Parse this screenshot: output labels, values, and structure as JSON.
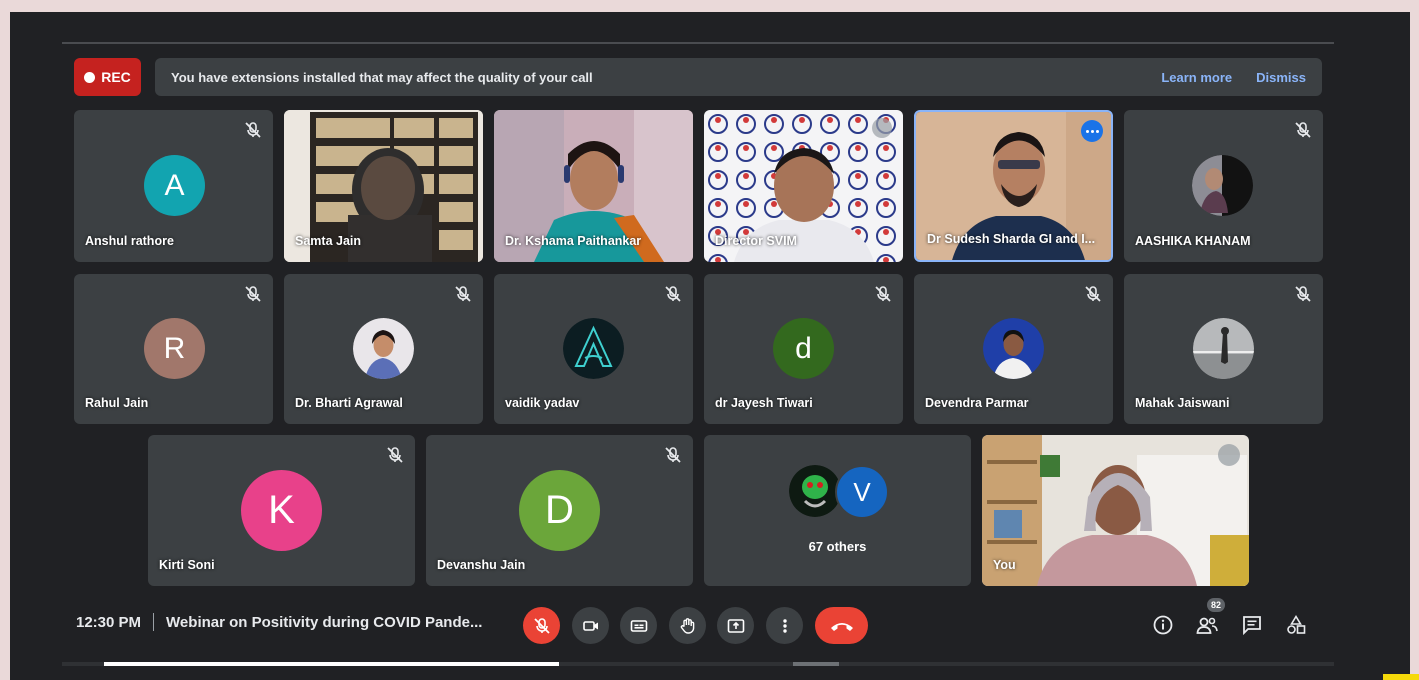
{
  "recording": {
    "label": "REC"
  },
  "notice": {
    "text": "You have extensions installed that may affect the quality of your call",
    "learn_more": "Learn more",
    "dismiss": "Dismiss"
  },
  "tiles": {
    "anshul": {
      "name": "Anshul rathore",
      "initial": "A",
      "color": "#12a4b0"
    },
    "samta": {
      "name": "Samta Jain"
    },
    "kshama": {
      "name": "Dr. Kshama Paithankar"
    },
    "director": {
      "name": "Director SVIM"
    },
    "sudesh": {
      "name": "Dr Sudesh Sharda GI and I..."
    },
    "aashika": {
      "name": "AASHIKA KHANAM"
    },
    "rahul": {
      "name": "Rahul Jain",
      "initial": "R",
      "color": "#a1776b"
    },
    "bharti": {
      "name": "Dr. Bharti Agrawal"
    },
    "vaidik": {
      "name": "vaidik yadav"
    },
    "jayesh": {
      "name": "dr Jayesh Tiwari",
      "initial": "d",
      "color": "#33691e"
    },
    "devendra": {
      "name": "Devendra Parmar"
    },
    "mahak": {
      "name": "Mahak Jaiswani"
    },
    "kirti": {
      "name": "Kirti Soni",
      "initial": "K",
      "color": "#e8418a"
    },
    "devanshu": {
      "name": "Devanshu Jain",
      "initial": "D",
      "color": "#6ba63a"
    },
    "others": {
      "label": "67 others",
      "initial": "V",
      "color": "#1565c0"
    },
    "you": {
      "name": "You"
    }
  },
  "meeting": {
    "time": "12:30 PM",
    "title": "Webinar on Positivity during COVID Pande..."
  },
  "controls": {
    "mic": {
      "icon": "mic-off-icon",
      "state": "off",
      "color": "#ea4335"
    },
    "camera": {
      "icon": "videocam-icon"
    },
    "captions": {
      "icon": "closed-caption-icon"
    },
    "raise_hand": {
      "icon": "hand-icon"
    },
    "present": {
      "icon": "present-screen-icon"
    },
    "more": {
      "icon": "more-vert-icon"
    },
    "end_call": {
      "icon": "call-end-icon",
      "color": "#ea4335"
    },
    "info": {
      "icon": "info-icon"
    },
    "people": {
      "icon": "people-icon",
      "count": "82"
    },
    "chat": {
      "icon": "chat-icon"
    },
    "activities": {
      "icon": "activities-icon"
    }
  },
  "colors": {
    "background": "#202124",
    "tile": "#3c4043",
    "accent": "#8ab4f8",
    "rec": "#c5221f"
  },
  "progress": {
    "fraction": 0.27
  }
}
